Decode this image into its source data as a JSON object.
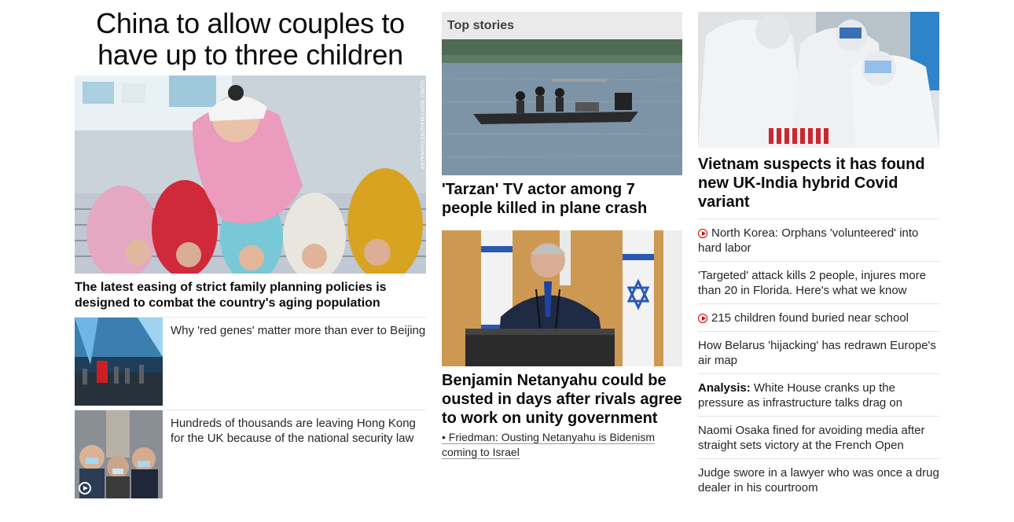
{
  "lead": {
    "headline": "China to allow couples to have up to three children",
    "photo_credit": "GUNG BOY/IMAGINECHINA/AP",
    "caption": "The latest easing of strict family planning policies is designed to combat the country's aging population",
    "related": [
      {
        "text": "Why 'red genes' matter more than ever to Beijing",
        "video": false
      },
      {
        "text": "Hundreds of thousands are leaving Hong Kong for the UK because of the national security law",
        "video": true
      }
    ]
  },
  "top_stories": {
    "section_title": "Top stories",
    "story1": {
      "title": "'Tarzan' TV actor among 7 people killed in plane crash"
    },
    "story2": {
      "title": "Benjamin Netanyahu could be ousted in days after rivals agree to work on unity government",
      "sub_link": "• Friedman: Ousting Netanyahu is Bidenism coming to Israel"
    }
  },
  "right_column": {
    "title": "Vietnam suspects it has found new UK-India hybrid Covid variant",
    "items": [
      {
        "text": "North Korea: Orphans 'volunteered' into hard labor",
        "video": true
      },
      {
        "text": "'Targeted' attack kills 2 people, injures more than 20 in Florida. Here's what we know",
        "video": false
      },
      {
        "text": "215 children found buried near school",
        "video": true
      },
      {
        "text": "How Belarus 'hijacking' has redrawn Europe's air map",
        "video": false
      },
      {
        "prefix": "Analysis:",
        "text": "White House cranks up the pressure as infrastructure talks drag on",
        "video": false
      },
      {
        "text": "Naomi Osaka fined for avoiding media after straight sets victory at the French Open",
        "video": false
      },
      {
        "text": "Judge swore in a lawyer who was once a drug dealer in his courtroom",
        "video": false
      }
    ]
  },
  "colors": {
    "accent_red": "#cc0000",
    "section_bg": "#eaeaea"
  }
}
